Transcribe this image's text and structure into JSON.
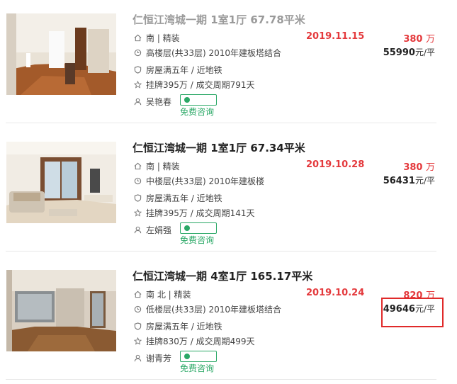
{
  "listings": [
    {
      "title": "仁恒江湾城一期 1室1厅 67.78平米",
      "orientation": "南 | 精装",
      "floor": "高楼层(共33层) 2010年建板塔结合",
      "tag": "房屋满五年 / 近地铁",
      "listing_info": "挂牌395万 / 成交周期791天",
      "agent": "吴艳春",
      "consult": "免费咨询",
      "date": "2019.11.15",
      "price": "380",
      "price_unit": "万",
      "unit_price": "55990",
      "unit_price_suffix": "元/平"
    },
    {
      "title": "仁恒江湾城一期 1室1厅 67.34平米",
      "orientation": "南 | 精装",
      "floor": "中楼层(共33层) 2010年建板楼",
      "tag": "房屋满五年 / 近地铁",
      "listing_info": "挂牌395万 / 成交周期141天",
      "agent": "左娟强",
      "consult": "免费咨询",
      "date": "2019.10.28",
      "price": "380",
      "price_unit": "万",
      "unit_price": "56431",
      "unit_price_suffix": "元/平"
    },
    {
      "title": "仁恒江湾城一期 4室1厅 165.17平米",
      "orientation": "南 北 | 精装",
      "floor": "低楼层(共33层) 2010年建板塔结合",
      "tag": "房屋满五年 / 近地铁",
      "listing_info": "挂牌830万 / 成交周期499天",
      "agent": "谢青芳",
      "consult": "免费咨询",
      "date": "2019.10.24",
      "price": "820",
      "price_unit": "万",
      "unit_price": "49646",
      "unit_price_suffix": "元/平"
    }
  ],
  "icons": [
    "home-icon",
    "clock-icon",
    "shield-icon",
    "star-icon",
    "person-icon",
    "chat-icon"
  ],
  "colors": {
    "price": "#e4393c",
    "consult": "#2aa866",
    "highlight": "#e02a2a"
  }
}
